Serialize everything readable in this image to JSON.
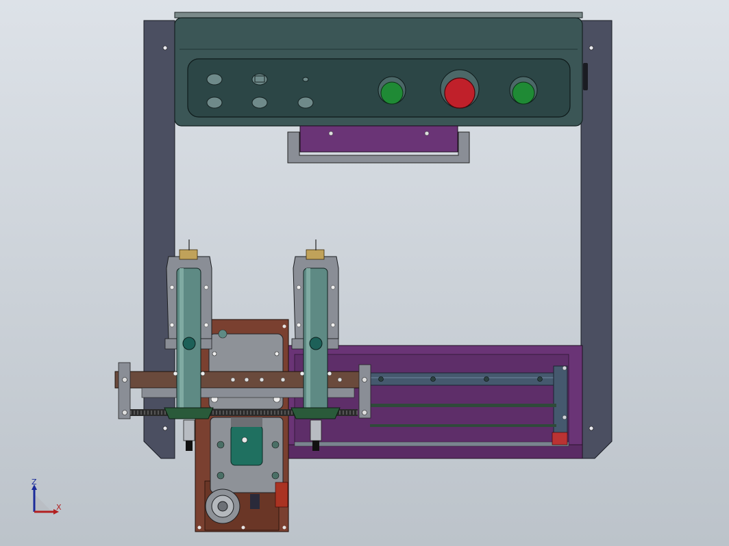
{
  "view": {
    "background_top": "#dde2e8",
    "background_bottom": "#bcc3ca"
  },
  "colors": {
    "frame_gray": "#4b4f61",
    "control_box": "#3b5656",
    "panel_bezel": "#2c4646",
    "purple_plate": "#6a3476",
    "rail_blue": "#45596e",
    "bar_brown": "#6a4a3c",
    "plate_brown": "#7a4030",
    "cylinder_teal": "#5e8a84",
    "housing_gray": "#8a8e96",
    "button_green": "#1f8a35",
    "estop_red": "#c0202a",
    "nozzle_black": "#111111"
  },
  "control_panel": {
    "indicators_row1": 3,
    "indicators_row2": 3,
    "push_buttons": [
      "green-start",
      "red-emergency-stop",
      "green-reset"
    ]
  },
  "dispense_heads": 2,
  "triad": {
    "z_label": "Z",
    "x_label": "X"
  }
}
